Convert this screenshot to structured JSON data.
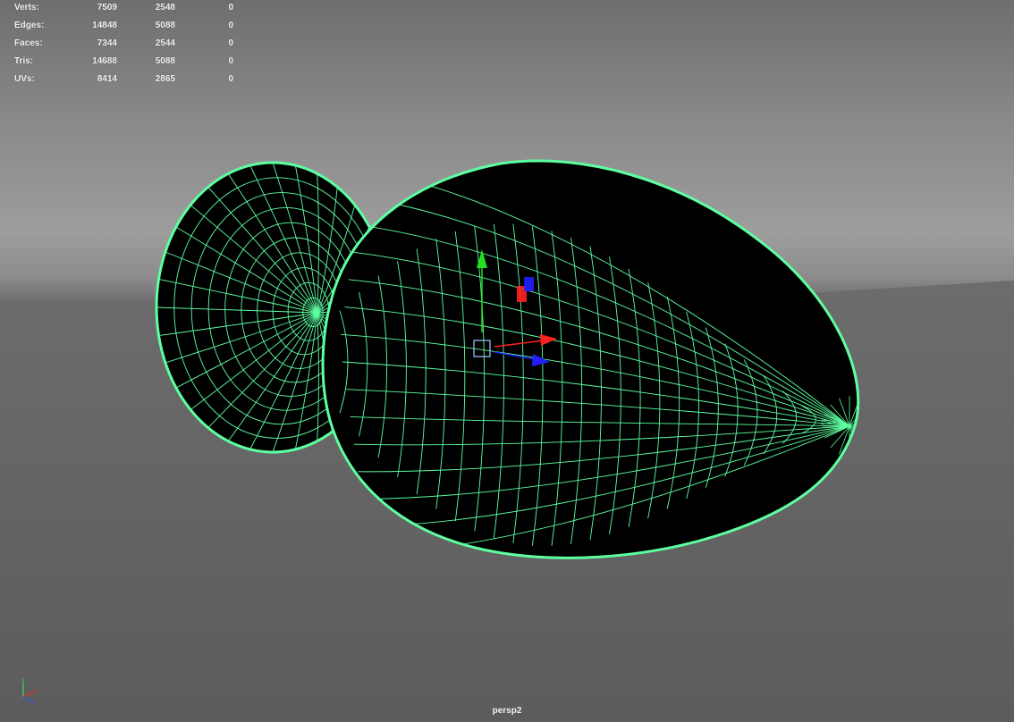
{
  "stats": {
    "rows": [
      {
        "label": "Verts:",
        "c1": "7509",
        "c2": "2548",
        "c3": "0"
      },
      {
        "label": "Edges:",
        "c1": "14848",
        "c2": "5088",
        "c3": "0"
      },
      {
        "label": "Faces:",
        "c1": "7344",
        "c2": "2544",
        "c3": "0"
      },
      {
        "label": "Tris:",
        "c1": "14688",
        "c2": "5088",
        "c3": "0"
      },
      {
        "label": "UVs:",
        "c1": "8414",
        "c2": "2865",
        "c3": "0"
      }
    ]
  },
  "viewport": {
    "camera_name": "persp2",
    "wireframe_color": "#5dffa0",
    "mesh_fill_color": "#000000"
  },
  "gizmo": {
    "x_axis_color": "#ff2020",
    "y_axis_color": "#20e020",
    "z_axis_color": "#2020ff"
  },
  "axis_indicator": {
    "y_label": "y",
    "x_label": "x",
    "z_label": "z"
  }
}
